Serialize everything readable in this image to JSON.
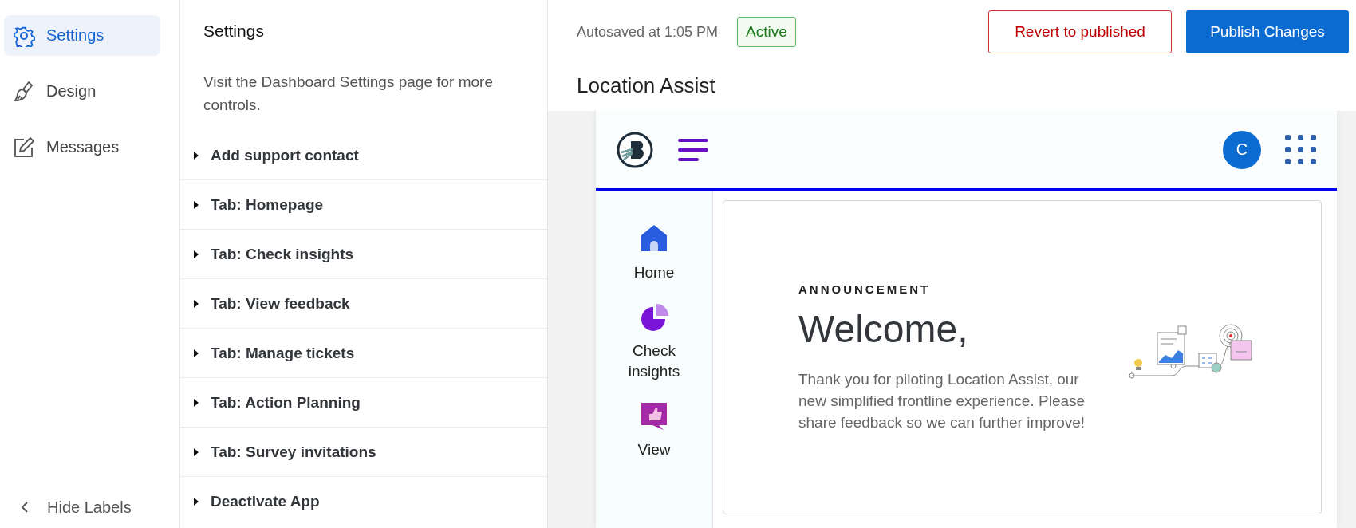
{
  "nav": {
    "items": [
      {
        "kind": "gear",
        "label": "Settings",
        "selected": true
      },
      {
        "kind": "brush",
        "label": "Design",
        "selected": false
      },
      {
        "kind": "pencil",
        "label": "Messages",
        "selected": false
      }
    ],
    "hide_labels": "Hide Labels"
  },
  "settings_panel": {
    "title": "Settings",
    "description": "Visit the Dashboard Settings page for more controls.",
    "sections": [
      {
        "label": "Add support contact",
        "expanded": false
      },
      {
        "label": "Tab: Homepage",
        "expanded": false
      },
      {
        "label": "Tab: Check insights",
        "expanded": false
      },
      {
        "label": "Tab: View feedback",
        "expanded": false
      },
      {
        "label": "Tab: Manage tickets",
        "expanded": false
      },
      {
        "label": "Tab: Action Planning",
        "expanded": false
      },
      {
        "label": "Tab: Survey invitations",
        "expanded": false
      },
      {
        "label": "Deactivate App",
        "expanded": false
      }
    ]
  },
  "toolbar": {
    "autosave": "Autosaved at 1:05 PM",
    "status": "Active",
    "revert": "Revert to published",
    "publish": "Publish Changes"
  },
  "page_title": "Location Assist",
  "preview": {
    "avatar": "C",
    "nav": [
      {
        "kind": "home",
        "label": "Home"
      },
      {
        "kind": "insights",
        "label": "Check insights"
      },
      {
        "kind": "feedback",
        "label": "View"
      }
    ],
    "announcement": {
      "eyebrow": "ANNOUNCEMENT",
      "heading": "Welcome,",
      "body": "Thank you for piloting Location Assist, our new simplified frontline experience. Please share feedback so we can further improve!"
    }
  }
}
